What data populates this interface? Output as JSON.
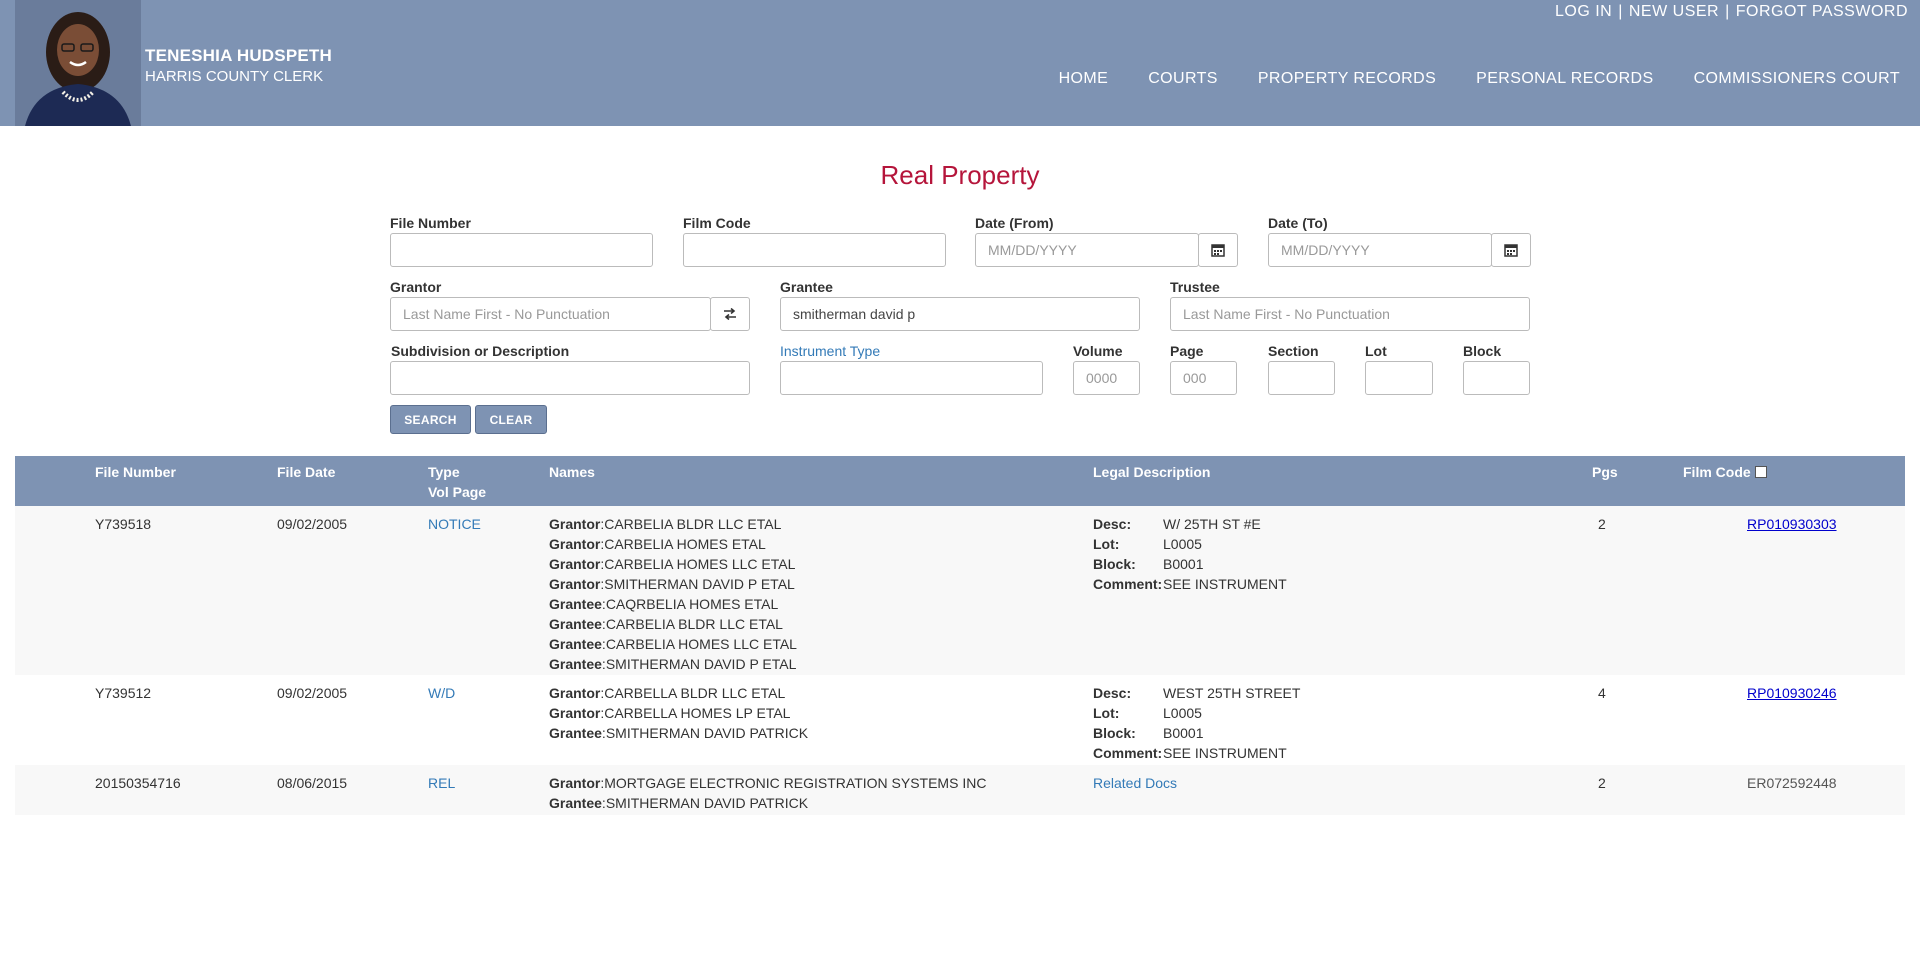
{
  "header": {
    "official_name": "TENESHIA HUDSPETH",
    "office": "HARRIS COUNTY CLERK",
    "top_links": [
      "LOG IN",
      "NEW USER",
      "FORGOT PASSWORD"
    ],
    "top_sep": "|",
    "nav": [
      "HOME",
      "COURTS",
      "PROPERTY RECORDS",
      "PERSONAL RECORDS",
      "COMMISSIONERS COURT"
    ]
  },
  "page_title": "Real Property",
  "form": {
    "file_number": {
      "label": "File Number",
      "value": ""
    },
    "film_code": {
      "label": "Film Code",
      "value": ""
    },
    "date_from": {
      "label": "Date (From)",
      "placeholder": "MM/DD/YYYY"
    },
    "date_to": {
      "label": "Date (To)",
      "placeholder": "MM/DD/YYYY"
    },
    "grantor": {
      "label": "Grantor",
      "placeholder": "Last Name First - No Punctuation"
    },
    "grantee": {
      "label": "Grantee",
      "value": "smitherman david p"
    },
    "trustee": {
      "label": "Trustee",
      "placeholder": "Last Name First - No Punctuation"
    },
    "subdivision": {
      "label": "Subdivision or Description",
      "value": ""
    },
    "instrument_type": {
      "label": "Instrument Type",
      "value": ""
    },
    "volume": {
      "label": "Volume",
      "placeholder": "0000"
    },
    "page": {
      "label": "Page",
      "placeholder": "000"
    },
    "section": {
      "label": "Section",
      "value": ""
    },
    "lot": {
      "label": "Lot",
      "value": ""
    },
    "block": {
      "label": "Block",
      "value": ""
    },
    "search_button": "SEARCH",
    "clear_button": "CLEAR"
  },
  "table": {
    "headers": {
      "file_number": "File Number",
      "file_date": "File Date",
      "type": "Type",
      "vol_page": "Vol Page",
      "names": "Names",
      "legal": "Legal Description",
      "pgs": "Pgs",
      "film_code": "Film Code"
    },
    "rows": [
      {
        "file_number": "Y739518",
        "file_date": "09/02/2005",
        "type": "NOTICE",
        "names": [
          {
            "role": "Grantor",
            "name": "CARBELIA BLDR LLC ETAL"
          },
          {
            "role": "Grantor",
            "name": "CARBELIA HOMES ETAL"
          },
          {
            "role": "Grantor",
            "name": "CARBELIA HOMES LLC ETAL"
          },
          {
            "role": "Grantor",
            "name": "SMITHERMAN DAVID P ETAL"
          },
          {
            "role": "Grantee",
            "name": "CAQRBELIA HOMES ETAL"
          },
          {
            "role": "Grantee",
            "name": "CARBELIA BLDR LLC ETAL"
          },
          {
            "role": "Grantee",
            "name": "CARBELIA HOMES LLC ETAL"
          },
          {
            "role": "Grantee",
            "name": "SMITHERMAN DAVID P ETAL"
          }
        ],
        "legal": [
          {
            "key": "Desc:",
            "value": "W/ 25TH ST #E"
          },
          {
            "key": "Lot:",
            "value": "L0005"
          },
          {
            "key": "Block:",
            "value": "B0001"
          },
          {
            "key": "Comment:",
            "value": "SEE INSTRUMENT"
          }
        ],
        "pgs": "2",
        "film_code": "RP010930303"
      },
      {
        "file_number": "Y739512",
        "file_date": "09/02/2005",
        "type": "W/D",
        "names": [
          {
            "role": "Grantor",
            "name": "CARBELLA BLDR LLC ETAL"
          },
          {
            "role": "Grantor",
            "name": "CARBELLA HOMES LP ETAL"
          },
          {
            "role": "Grantee",
            "name": "SMITHERMAN DAVID PATRICK"
          }
        ],
        "legal": [
          {
            "key": "Desc:",
            "value": "WEST 25TH STREET"
          },
          {
            "key": "Lot:",
            "value": "L0005"
          },
          {
            "key": "Block:",
            "value": "B0001"
          },
          {
            "key": "Comment:",
            "value": "SEE INSTRUMENT"
          }
        ],
        "pgs": "4",
        "film_code": "RP010930246"
      },
      {
        "file_number": "20150354716",
        "file_date": "08/06/2015",
        "type": "REL",
        "names": [
          {
            "role": "Grantor",
            "name": "MORTGAGE ELECTRONIC REGISTRATION SYSTEMS INC"
          },
          {
            "role": "Grantee",
            "name": "SMITHERMAN DAVID PATRICK"
          }
        ],
        "legal_link": "Related Docs",
        "pgs": "2",
        "film_code": "ER072592448"
      }
    ]
  },
  "colors": {
    "header_bg": "#7e93b3",
    "title_red": "#b5153b",
    "link_blue": "#337ab7"
  }
}
